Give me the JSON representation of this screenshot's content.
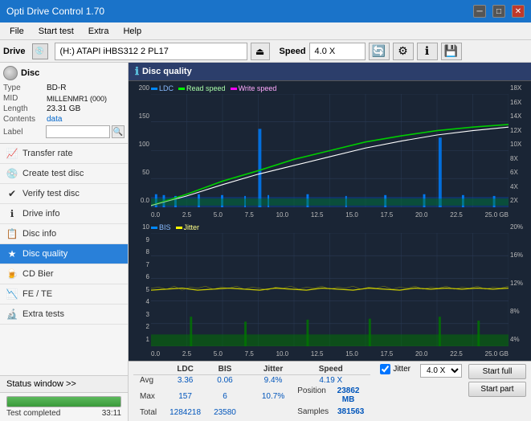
{
  "titleBar": {
    "title": "Opti Drive Control 1.70",
    "minBtn": "─",
    "maxBtn": "□",
    "closeBtn": "✕"
  },
  "menuBar": {
    "items": [
      "File",
      "Start test",
      "Extra",
      "Help"
    ]
  },
  "driveBar": {
    "label": "Drive",
    "driveValue": "(H:) ATAPI iHBS312  2 PL17",
    "speedLabel": "Speed",
    "speedValue": "4.0 X"
  },
  "discPanel": {
    "title": "Disc",
    "typeLabel": "Type",
    "typeValue": "BD-R",
    "midLabel": "MID",
    "midValue": "MILLENMR1 (000)",
    "lengthLabel": "Length",
    "lengthValue": "23.31 GB",
    "contentsLabel": "Contents",
    "contentsValue": "data",
    "labelLabel": "Label",
    "labelValue": ""
  },
  "navItems": [
    {
      "id": "transfer-rate",
      "label": "Transfer rate",
      "icon": "📈"
    },
    {
      "id": "create-test-disc",
      "label": "Create test disc",
      "icon": "💿"
    },
    {
      "id": "verify-test-disc",
      "label": "Verify test disc",
      "icon": "✔"
    },
    {
      "id": "drive-info",
      "label": "Drive info",
      "icon": "ℹ"
    },
    {
      "id": "disc-info",
      "label": "Disc info",
      "icon": "📋"
    },
    {
      "id": "disc-quality",
      "label": "Disc quality",
      "icon": "★",
      "active": true
    },
    {
      "id": "cd-bier",
      "label": "CD Bier",
      "icon": "🍺"
    },
    {
      "id": "fe-te",
      "label": "FE / TE",
      "icon": "📉"
    },
    {
      "id": "extra-tests",
      "label": "Extra tests",
      "icon": "🔬"
    }
  ],
  "statusWindow": {
    "label": "Status window >>",
    "statusText": "Test completed",
    "progressPct": 100,
    "time": "33:11"
  },
  "discQuality": {
    "title": "Disc quality",
    "chart1": {
      "legend": [
        {
          "label": "LDC",
          "color": "#0088ff"
        },
        {
          "label": "Read speed",
          "color": "#00dd00"
        },
        {
          "label": "Write speed",
          "color": "#ff66ff"
        }
      ],
      "yLeft": [
        "200",
        "150",
        "100",
        "50",
        "0.0"
      ],
      "yRight": [
        "18X",
        "16X",
        "14X",
        "12X",
        "10X",
        "8X",
        "6X",
        "4X",
        "2X"
      ],
      "xAxis": [
        "0.0",
        "2.5",
        "5.0",
        "7.5",
        "10.0",
        "12.5",
        "15.0",
        "17.5",
        "20.0",
        "22.5",
        "25.0 GB"
      ]
    },
    "chart2": {
      "legend": [
        {
          "label": "BIS",
          "color": "#0088ff"
        },
        {
          "label": "Jitter",
          "color": "#dddd00"
        }
      ],
      "yLeft": [
        "10",
        "9",
        "8",
        "7",
        "6",
        "5",
        "4",
        "3",
        "2",
        "1"
      ],
      "yRight": [
        "20%",
        "16%",
        "12%",
        "8%",
        "4%"
      ],
      "xAxis": [
        "0.0",
        "2.5",
        "5.0",
        "7.5",
        "10.0",
        "12.5",
        "15.0",
        "17.5",
        "20.0",
        "22.5",
        "25.0 GB"
      ]
    }
  },
  "stats": {
    "headers": [
      "LDC",
      "BIS",
      "",
      "Jitter",
      "Speed",
      ""
    ],
    "avgLabel": "Avg",
    "avgLDC": "3.36",
    "avgBIS": "0.06",
    "avgJitter": "9.4%",
    "avgSpeed": "4.19 X",
    "avgSpeedSelect": "4.0 X",
    "maxLabel": "Max",
    "maxLDC": "157",
    "maxBIS": "6",
    "maxJitter": "10.7%",
    "posLabel": "Position",
    "posValue": "23862 MB",
    "totalLabel": "Total",
    "totalLDC": "1284218",
    "totalBIS": "23580",
    "samplesLabel": "Samples",
    "samplesValue": "381563",
    "jitterChecked": true,
    "startFull": "Start full",
    "startPart": "Start part"
  }
}
